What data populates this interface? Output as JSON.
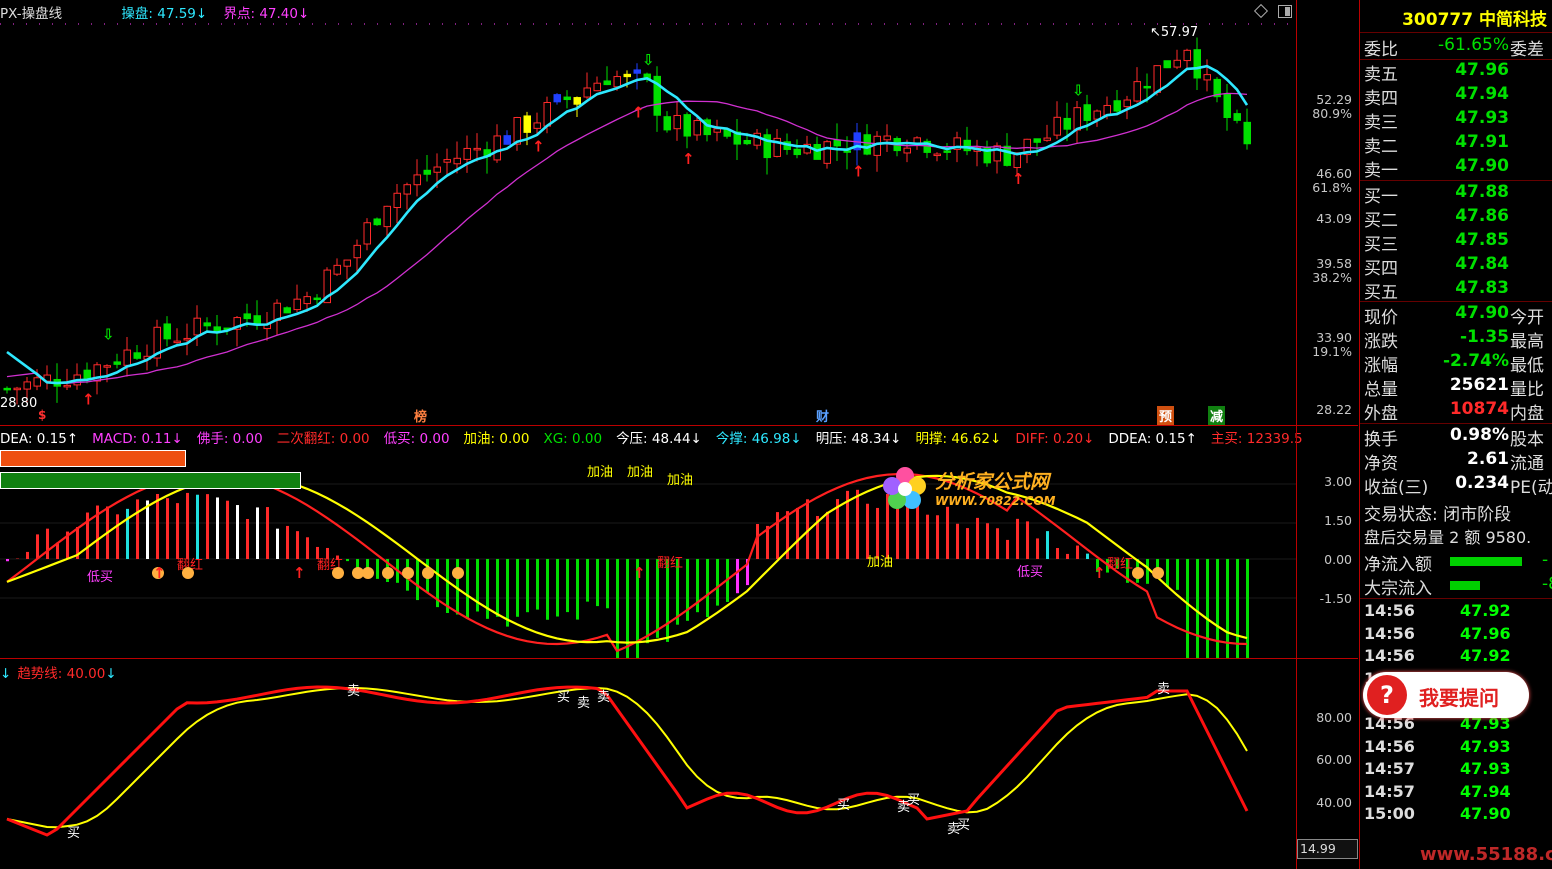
{
  "colors": {
    "up": "#ff2a2a",
    "down": "#00e000",
    "ma_fast": "#2ee8ff",
    "ma_slow": "#d030d0",
    "signal": "#ffff00",
    "axis_border": "#b00000",
    "background": "#000000"
  },
  "main": {
    "header": {
      "title": "PX-操盘线",
      "items": [
        {
          "label": "操盘: 47.59",
          "arrow": "↓",
          "color": "#2ee8ff"
        },
        {
          "label": "界点: 47.40",
          "arrow": "↓",
          "color": "#ff40ff"
        }
      ]
    },
    "price_ticks": [
      "52.29",
      "80.9%",
      "46.60",
      "61.8%",
      "43.09",
      "39.58",
      "38.2%",
      "33.90",
      "19.1%",
      "28.22"
    ],
    "high_label": "57.97",
    "low_label": "28.80",
    "markers": [
      {
        "text": "榜",
        "color": "#ff8040"
      },
      {
        "text": "财",
        "color": "#5aa0ff"
      },
      {
        "text": "预",
        "color": "#ff8040"
      },
      {
        "text": "减",
        "color": "#00e000"
      },
      {
        "text": "$",
        "color": "#ff3030"
      }
    ],
    "icons": [
      "diamond-icon",
      "window-toggle-icon"
    ]
  },
  "macd": {
    "header": [
      {
        "label": "DEA: 0.15↑",
        "color": "#ffffff"
      },
      {
        "label": "MACD: 0.11↓",
        "color": "#ff40ff"
      },
      {
        "label": "佛手: 0.00",
        "color": "#ff40ff"
      },
      {
        "label": "二次翻红: 0.00",
        "color": "#ff2a2a"
      },
      {
        "label": "低买: 0.00",
        "color": "#ff40ff"
      },
      {
        "label": "加油: 0.00",
        "color": "#ffff00"
      },
      {
        "label": "XG: 0.00",
        "color": "#00e000"
      },
      {
        "label": "今压: 48.44↓",
        "color": "#ffffff"
      },
      {
        "label": "今撑: 46.98↓",
        "color": "#2ee8ff"
      },
      {
        "label": "明压: 48.34↓",
        "color": "#ffffff"
      },
      {
        "label": "明撑: 46.62↓",
        "color": "#ffff00"
      },
      {
        "label": "DIFF: 0.20↓",
        "color": "#ff2a2a"
      },
      {
        "label": "DDEA: 0.15↑",
        "color": "#ffffff"
      },
      {
        "label": "主买: 12339.5",
        "color": "#ff2a2a"
      }
    ],
    "ticks": [
      "3.00",
      "1.50",
      "0.00",
      "-1.50"
    ],
    "labels": {
      "fuel": "加油",
      "low_buy": "低买",
      "red_again": "翻红"
    },
    "watermark": {
      "name": "分析家公式网",
      "url": "WWW.70822.COM"
    }
  },
  "trend": {
    "header": {
      "label": "趋势线: 40.00",
      "color": "#ff2a2a"
    },
    "ticks": [
      "80.00",
      "60.00",
      "40.00"
    ],
    "corner_value": "14.99",
    "labels": {
      "buy": "买",
      "sell": "卖"
    }
  },
  "side": {
    "code": "300777",
    "name": "中简科技",
    "ratio_row": {
      "label": "委比",
      "value": "-61.65%",
      "extra": "委差"
    },
    "asks": [
      {
        "label": "卖五",
        "price": "47.96"
      },
      {
        "label": "卖四",
        "price": "47.94"
      },
      {
        "label": "卖三",
        "price": "47.93"
      },
      {
        "label": "卖二",
        "price": "47.91"
      },
      {
        "label": "卖一",
        "price": "47.90"
      }
    ],
    "bids": [
      {
        "label": "买一",
        "price": "47.88"
      },
      {
        "label": "买二",
        "price": "47.86"
      },
      {
        "label": "买三",
        "price": "47.85"
      },
      {
        "label": "买四",
        "price": "47.84"
      },
      {
        "label": "买五",
        "price": "47.83"
      }
    ],
    "quote": [
      {
        "label": "现价",
        "value": "47.90",
        "extra": "今开",
        "color": "#00e000"
      },
      {
        "label": "涨跌",
        "value": "-1.35",
        "extra": "最高",
        "color": "#00e000"
      },
      {
        "label": "涨幅",
        "value": "-2.74%",
        "extra": "最低",
        "color": "#00e000"
      },
      {
        "label": "总量",
        "value": "25621",
        "extra": "量比",
        "color": "#ffffff"
      },
      {
        "label": "外盘",
        "value": "10874",
        "extra": "内盘",
        "color": "#ff2a2a"
      }
    ],
    "stats": [
      {
        "label": "换手",
        "value": "0.98%",
        "extra": "股本"
      },
      {
        "label": "净资",
        "value": "2.61",
        "extra": "流通"
      },
      {
        "label": "收益(三)",
        "value": "0.234",
        "extra": "PE(动"
      }
    ],
    "status": "交易状态: 闭市阶段",
    "after_hours": "盘后交易量 2 额 9580.",
    "flows": [
      {
        "label": "净流入额",
        "bar": 0.85,
        "tail": "-"
      },
      {
        "label": "大宗流入",
        "bar": 0.35,
        "tail": "-8"
      }
    ],
    "ticks": [
      {
        "time": "14:56",
        "price": "47.92"
      },
      {
        "time": "14:56",
        "price": "47.96"
      },
      {
        "time": "14:56",
        "price": "47.92"
      },
      {
        "time": "14:56",
        "price": "47.96"
      },
      {
        "time": "14:56",
        "price": "47.94"
      },
      {
        "time": "14:56",
        "price": "47.93"
      },
      {
        "time": "14:56",
        "price": "47.93"
      },
      {
        "time": "14:57",
        "price": "47.93"
      },
      {
        "time": "14:57",
        "price": "47.94"
      },
      {
        "time": "15:00",
        "price": "47.90"
      }
    ],
    "ask_button": "我要提问",
    "site_watermark": "www.55188.com"
  }
}
